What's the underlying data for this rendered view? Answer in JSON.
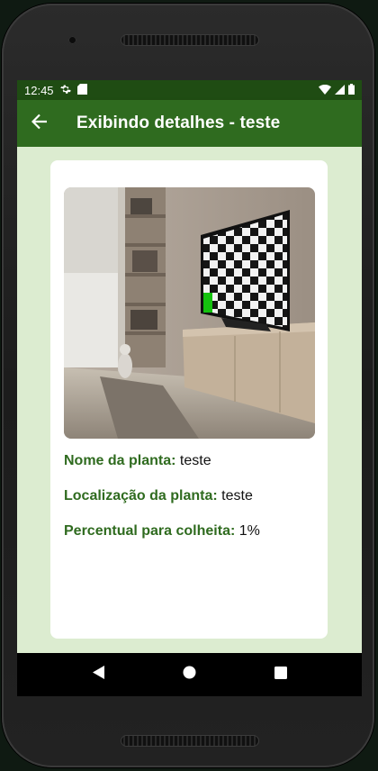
{
  "status_bar": {
    "time": "12:45",
    "left_icons": [
      "gear-icon",
      "sd-card-icon"
    ],
    "right_icons": [
      "wifi-icon",
      "signal-icon",
      "battery-icon"
    ]
  },
  "app_bar": {
    "title": "Exibindo detalhes - teste",
    "back_icon": "arrow-left-icon",
    "background": "#2f6b1f"
  },
  "plant": {
    "image_description_icon": "plant-photo",
    "name_label": "Nome da planta:",
    "name_value": " teste",
    "location_label": "Localização da planta:",
    "location_value": " teste",
    "harvest_label": "Percentual para colheita:",
    "harvest_value": " 1%"
  },
  "nav_bar": {
    "icons": [
      "back-triangle-icon",
      "home-circle-icon",
      "recents-square-icon"
    ]
  },
  "colors": {
    "accent_green": "#2f6b1f",
    "status_green": "#1f4c13",
    "screen_bg": "#dcecd0"
  }
}
